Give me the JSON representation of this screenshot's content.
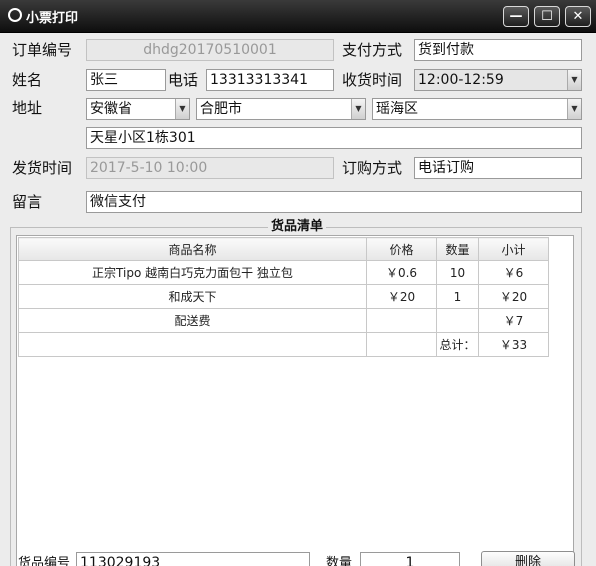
{
  "window": {
    "title": "小票打印",
    "minimize": "—",
    "maximize": "☐",
    "close": "✕"
  },
  "labels": {
    "order_no": "订单编号",
    "payment": "支付方式",
    "name": "姓名",
    "phone": "电话",
    "receive_time": "收货时间",
    "address": "地址",
    "ship_time": "发货时间",
    "order_method": "订购方式",
    "message": "留言",
    "goods_list": "货品清单",
    "goods_no": "货品编号",
    "qty": "数量",
    "delete": "删除"
  },
  "form": {
    "order_no": "dhdg20170510001",
    "payment": "货到付款",
    "name": "张三",
    "phone": "13313313341",
    "receive_time": "12:00-12:59",
    "province": "安徽省",
    "city": "合肥市",
    "district": "瑶海区",
    "address_detail": "天星小区1栋301",
    "ship_time": "2017-5-10 10:00",
    "order_method": "电话订购",
    "message": "微信支付",
    "goods_no": "113029193",
    "qty": "1"
  },
  "table": {
    "headers": [
      "商品名称",
      "价格",
      "数量",
      "小计"
    ],
    "rows": [
      [
        "正宗Tipo 越南白巧克力面包干 独立包",
        "￥0.6",
        "10",
        "￥6"
      ],
      [
        "和成天下",
        "￥20",
        "1",
        "￥20"
      ],
      [
        "配送费",
        "",
        "",
        "￥7"
      ],
      [
        "",
        "",
        "总计：",
        "￥33"
      ]
    ]
  },
  "icons": {
    "dropdown": "chevron-down-icon",
    "app": "circle-app-icon"
  },
  "colors": {
    "titlebar": "#1a1a1a",
    "window_bg": "#ececec",
    "disabled_text": "#999999"
  }
}
